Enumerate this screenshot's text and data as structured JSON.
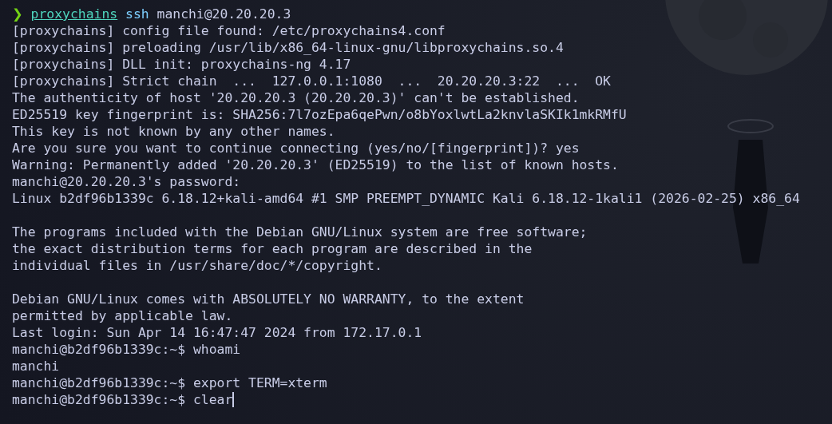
{
  "terminal": {
    "lines": [
      {
        "kind": "shell",
        "symbol": "❯",
        "words": [
          {
            "text": "proxychains",
            "kind": "wrapper"
          },
          {
            "text": "ssh",
            "kind": "command"
          },
          {
            "text": "manchi@20.20.20.3",
            "kind": "argument"
          }
        ]
      },
      {
        "kind": "output",
        "text": "[proxychains] config file found: /etc/proxychains4.conf"
      },
      {
        "kind": "output",
        "text": "[proxychains] preloading /usr/lib/x86_64-linux-gnu/libproxychains.so.4"
      },
      {
        "kind": "output",
        "text": "[proxychains] DLL init: proxychains-ng 4.17"
      },
      {
        "kind": "output",
        "text": "[proxychains] Strict chain  ...  127.0.0.1:1080  ...  20.20.20.3:22  ...  OK"
      },
      {
        "kind": "output",
        "text": "The authenticity of host '20.20.20.3 (20.20.20.3)' can't be established."
      },
      {
        "kind": "output",
        "text": "ED25519 key fingerprint is: SHA256:7l7ozEpa6qePwn/o8bYoxlwtLa2knvlaSKIk1mkRMfU"
      },
      {
        "kind": "output",
        "text": "This key is not known by any other names."
      },
      {
        "kind": "output",
        "text": "Are you sure you want to continue connecting (yes/no/[fingerprint])? yes"
      },
      {
        "kind": "output",
        "text": "Warning: Permanently added '20.20.20.3' (ED25519) to the list of known hosts."
      },
      {
        "kind": "output",
        "text": "manchi@20.20.20.3's password:"
      },
      {
        "kind": "output",
        "text": "Linux b2df96b1339c 6.18.12+kali-amd64 #1 SMP PREEMPT_DYNAMIC Kali 6.18.12-1kali1 (2026-02-25) x86_64"
      },
      {
        "kind": "blank"
      },
      {
        "kind": "output",
        "text": "The programs included with the Debian GNU/Linux system are free software;"
      },
      {
        "kind": "output",
        "text": "the exact distribution terms for each program are described in the"
      },
      {
        "kind": "output",
        "text": "individual files in /usr/share/doc/*/copyright."
      },
      {
        "kind": "blank"
      },
      {
        "kind": "output",
        "text": "Debian GNU/Linux comes with ABSOLUTELY NO WARRANTY, to the extent"
      },
      {
        "kind": "output",
        "text": "permitted by applicable law."
      },
      {
        "kind": "output",
        "text": "Last login: Sun Apr 14 16:47:47 2024 from 172.17.0.1"
      },
      {
        "kind": "prompt",
        "prompt": "manchi@b2df96b1339c:~$",
        "command": "whoami",
        "cursor": false
      },
      {
        "kind": "output",
        "text": "manchi"
      },
      {
        "kind": "prompt",
        "prompt": "manchi@b2df96b1339c:~$",
        "command": "export TERM=xterm",
        "cursor": false
      },
      {
        "kind": "prompt",
        "prompt": "manchi@b2df96b1339c:~$",
        "command": "clear",
        "cursor": true
      }
    ]
  }
}
